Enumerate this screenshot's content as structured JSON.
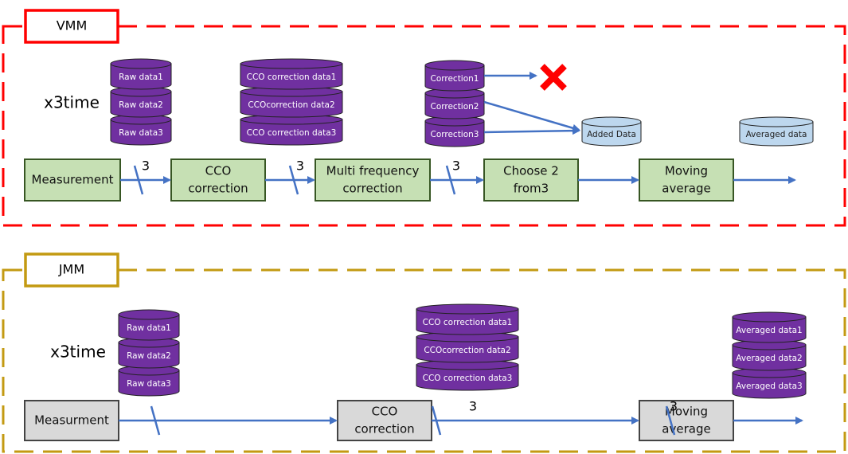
{
  "colors": {
    "vmm": "#ff0000",
    "jmm": "#c39a12",
    "arrow": "#4472c4",
    "green_box": "#c6e0b4",
    "green_border": "#375623",
    "gray_box": "#d9d9d9",
    "purple": "#7030a0",
    "light_blue": "#bdd7ee",
    "cross": "#ff0000"
  },
  "vmm": {
    "label": "VMM",
    "multiplier": "x3time",
    "processes": [
      "Measurement",
      "CCO|correction",
      "Multi frequency|correction",
      "Choose 2|from3",
      "Moving|average"
    ],
    "bus_counts": [
      "3",
      "3",
      "3"
    ],
    "raw_stack": [
      "Raw data1",
      "Raw data2",
      "Raw data3"
    ],
    "cco_stack": [
      "CCO correction data1",
      "CCOcorrection data2",
      "CCO correction data3"
    ],
    "correction_stack": [
      "Correction1",
      "Correction2",
      "Correction3"
    ],
    "added_data": "Added Data",
    "averaged_data": "Averaged data",
    "discard_icon": "red-x"
  },
  "jmm": {
    "label": "JMM",
    "multiplier": "x3time",
    "processes": [
      "Measurment",
      "CCO|correction",
      "Moving|average"
    ],
    "bus_counts": [
      "",
      "3",
      "3"
    ],
    "raw_stack": [
      "Raw data1",
      "Raw data2",
      "Raw data3"
    ],
    "cco_stack": [
      "CCO correction data1",
      "CCOcorrection data2",
      "CCO correction data3"
    ],
    "averaged_stack": [
      "Averaged data1",
      "Averaged data2",
      "Averaged data3"
    ]
  }
}
